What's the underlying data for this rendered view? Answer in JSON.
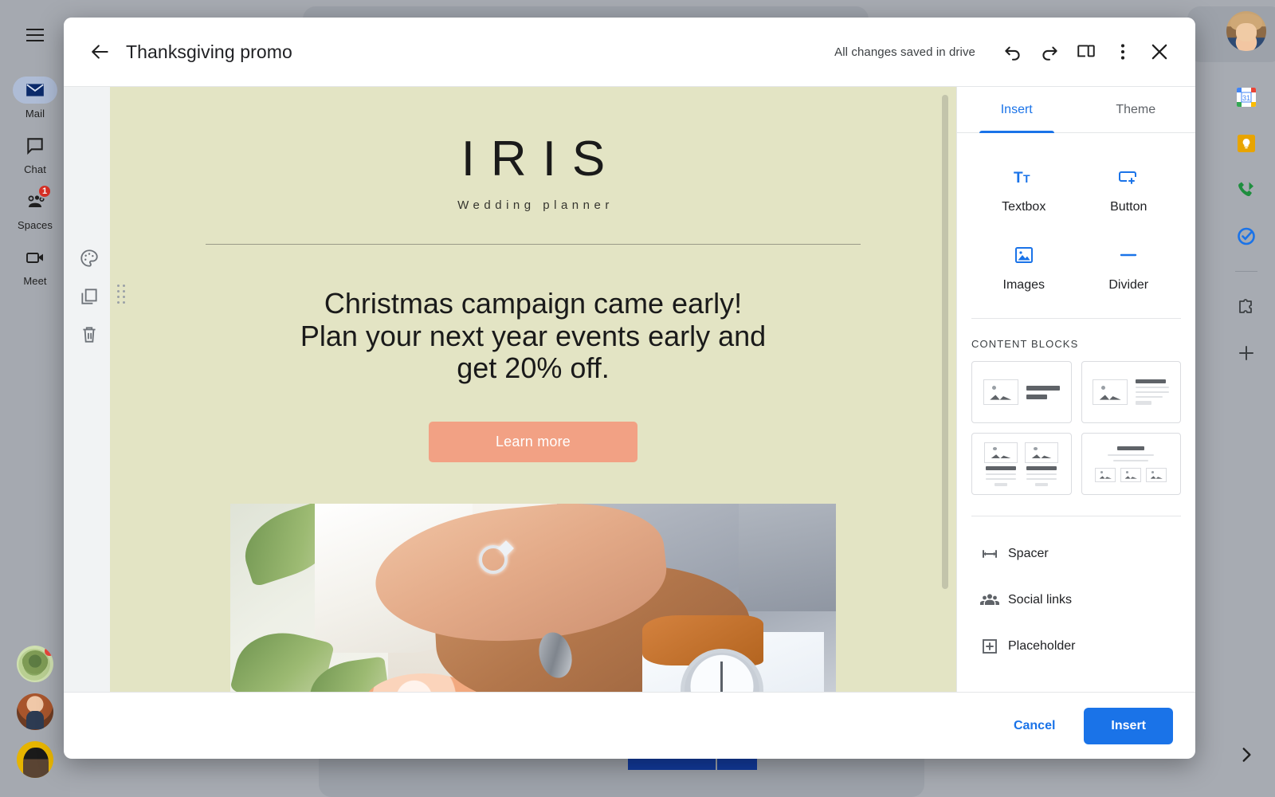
{
  "left_rail": {
    "menu_icon": "hamburger-menu-icon",
    "items": [
      {
        "label": "Mail",
        "icon": "mail-icon",
        "active": true,
        "badge": ""
      },
      {
        "label": "Chat",
        "icon": "chat-bubble-icon",
        "active": false,
        "badge": ""
      },
      {
        "label": "Spaces",
        "icon": "spaces-people-icon",
        "active": false,
        "badge": "1"
      },
      {
        "label": "Meet",
        "icon": "video-camera-icon",
        "active": false,
        "badge": ""
      }
    ],
    "contacts": [
      {
        "name": "contact-avatar-1",
        "has_notification": true
      },
      {
        "name": "contact-avatar-2",
        "has_notification": false
      },
      {
        "name": "contact-avatar-3",
        "has_notification": false
      }
    ]
  },
  "right_rail": {
    "account_avatar": "user-avatar",
    "apps": [
      {
        "name": "google-calendar-icon",
        "day": "31"
      },
      {
        "name": "google-keep-icon"
      },
      {
        "name": "google-voice-icon"
      },
      {
        "name": "google-tasks-icon"
      },
      {
        "name": "addons-puzzle-icon"
      },
      {
        "name": "add-plus-icon"
      }
    ],
    "expand_icon": "chevron-right-icon"
  },
  "header": {
    "back_icon": "arrow-left-icon",
    "title": "Thanksgiving promo",
    "save_status": "All changes saved in drive",
    "actions": [
      {
        "name": "undo-icon"
      },
      {
        "name": "redo-icon"
      },
      {
        "name": "device-preview-icon"
      },
      {
        "name": "more-options-icon"
      },
      {
        "name": "close-icon"
      }
    ]
  },
  "editor": {
    "block_tools": [
      {
        "name": "palette-style-icon"
      },
      {
        "name": "duplicate-icon"
      },
      {
        "name": "delete-trash-icon"
      }
    ],
    "drag_handle": "drag-handle-icon",
    "scrollbar": "vertical-scrollbar"
  },
  "email": {
    "background_color": "#e3e4c4",
    "brand_name": "IRIS",
    "brand_subtitle": "Wedding planner",
    "headline_line1": "Christmas campaign came early!",
    "headline_line2": "Plan your next year events early and",
    "headline_line3": "get 20% off.",
    "cta_label": "Learn more",
    "cta_color": "#f2a184",
    "hero_image": "wedding-hands-with-rings-photo"
  },
  "side_panel": {
    "tabs": [
      {
        "label": "Insert",
        "active": true
      },
      {
        "label": "Theme",
        "active": false
      }
    ],
    "accent_color": "#1a73e8",
    "insert_items": [
      {
        "label": "Textbox",
        "icon": "textbox-icon"
      },
      {
        "label": "Button",
        "icon": "button-icon"
      },
      {
        "label": "Images",
        "icon": "image-icon"
      },
      {
        "label": "Divider",
        "icon": "divider-icon"
      }
    ],
    "content_blocks_title": "CONTENT BLOCKS",
    "content_blocks": [
      {
        "name": "block-image-left-text-right"
      },
      {
        "name": "block-image-left-paragraph-right"
      },
      {
        "name": "block-two-columns-image-text"
      },
      {
        "name": "block-heading-three-images"
      }
    ],
    "list_items": [
      {
        "label": "Spacer",
        "icon": "spacer-icon"
      },
      {
        "label": "Social links",
        "icon": "social-people-icon"
      },
      {
        "label": "Placeholder",
        "icon": "placeholder-plus-icon"
      }
    ]
  },
  "footer": {
    "cancel_label": "Cancel",
    "insert_label": "Insert"
  }
}
